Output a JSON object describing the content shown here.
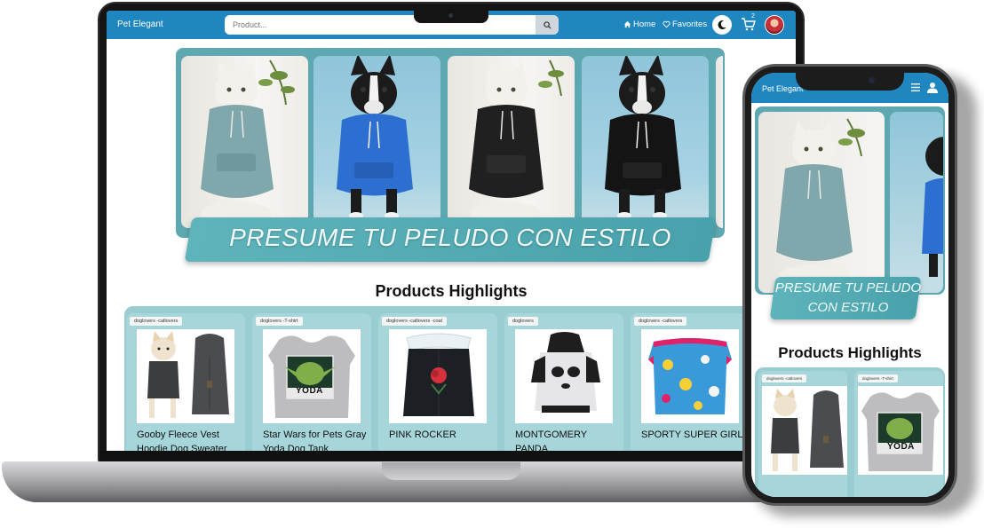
{
  "desktop": {
    "navbar": {
      "brand": "Pet Elegant",
      "search_placeholder": "Product...",
      "links": {
        "home": "Home",
        "favorites": "Favorites"
      },
      "cart_count": "2"
    },
    "banner": {
      "slogan": "PRESUME TU PELUDO CON ESTILO"
    },
    "section_title": "Products Highlights",
    "products": [
      {
        "tag": "doglovers -catlovers",
        "name": "Gooby Fleece Vest Hoodie Dog Sweater"
      },
      {
        "tag": "doglovers -T-shirt",
        "name": "Star Wars for Pets Gray Yoda Dog Tank"
      },
      {
        "tag": "doglovers -catlovers -coat",
        "name": "PINK ROCKER"
      },
      {
        "tag": "doglovers",
        "name": "MONTGOMERY PANDA"
      },
      {
        "tag": "doglovers -catlovers",
        "name": "SPORTY SUPER GIRL"
      }
    ],
    "product_print": "YODA"
  },
  "mobile": {
    "navbar": {
      "brand": "Pet Elegant"
    },
    "banner": {
      "slogan": "PRESUME TU PELUDO CON ESTILO"
    },
    "section_title": "Products Highlights",
    "products": [
      {
        "tag": "doglovers -catlovers"
      },
      {
        "tag": "doglovers -T-shirt"
      }
    ],
    "product_print": "YODA"
  },
  "colors": {
    "navbar": "#1f86bf",
    "banner_frame": "#5da8b1",
    "ribbon": "#4fa9b2",
    "products_panel": "#99cdd1"
  }
}
